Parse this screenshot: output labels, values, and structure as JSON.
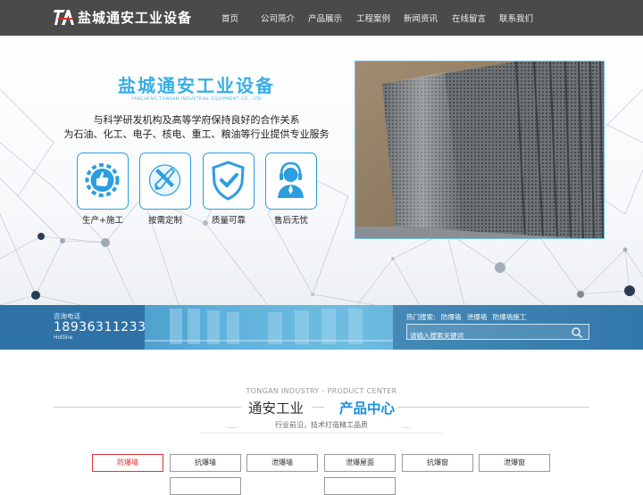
{
  "header": {
    "logo_text": "盐城通安工业设备",
    "nav": [
      "首页",
      "公司简介",
      "产品展示",
      "工程案例",
      "新闻资讯",
      "在线留言",
      "联系我们"
    ]
  },
  "banner": {
    "title": "盐城通安工业设备",
    "subtitle": "YANCHENG TONGAN INDUSTRIAL EQUIPMENT CO., LTD",
    "line1": "与科学研发机构及高等学府保持良好的合作关系",
    "line2": "为石油、化工、电子、核电、重工、粮油等行业提供专业服务",
    "features": [
      {
        "label": "生产+施工",
        "icon": "thumbs-up-gear-icon"
      },
      {
        "label": "按需定制",
        "icon": "pencil-ruler-icon"
      },
      {
        "label": "质量可靠",
        "icon": "shield-check-icon"
      },
      {
        "label": "售后无忧",
        "icon": "headset-agent-icon"
      }
    ],
    "photo_icon": "perforated-panel-photo"
  },
  "info_bar": {
    "consult_label": "咨询电话",
    "phone": "18936311233",
    "hotline_label": "Hotline",
    "hot_search_label": "热门搜索:",
    "hot_keywords": [
      "防爆墙",
      "泄爆墙",
      "防爆墙施工"
    ],
    "search_placeholder": "请输入搜索关键词"
  },
  "product_center": {
    "english": "TONGAN INDUSTRY - PRODUCT CENTER",
    "title_a": "通安工业",
    "title_b": "产品中心",
    "desc": "行业前沿，技术打造精工品质",
    "tabs": [
      "防爆墙",
      "抗爆墙",
      "泄爆墙",
      "泄爆屋面",
      "抗爆窗",
      "泄爆窗"
    ]
  },
  "colors": {
    "accent": "#1d8fd8",
    "nav_bg": "#4a4a4a",
    "active_tab": "#d33333"
  }
}
